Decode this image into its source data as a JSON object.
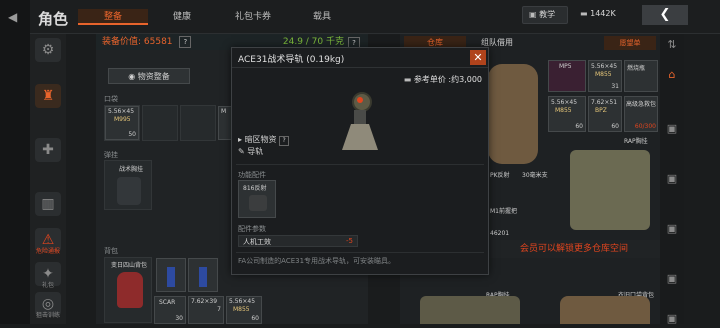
{
  "header": {
    "title": "角色",
    "tabs": [
      {
        "label": "整备",
        "active": true
      },
      {
        "label": "健康",
        "active": false
      },
      {
        "label": "礼包卡券",
        "active": false
      },
      {
        "label": "载具",
        "active": false
      }
    ],
    "teach_label": "教学",
    "currency_value": "1442K"
  },
  "sidebar": {
    "items": [
      {
        "icon": "robot-icon",
        "label": ""
      },
      {
        "icon": "equipment-icon",
        "label": ""
      },
      {
        "icon": "health-icon",
        "label": ""
      },
      {
        "icon": "bag-icon",
        "label": ""
      },
      {
        "icon": "alert-icon",
        "label": "危险通报"
      },
      {
        "icon": "gift-icon",
        "label": "礼包"
      },
      {
        "icon": "medal-icon",
        "label": "狙击训练"
      }
    ]
  },
  "left_panel": {
    "equip_value_label": "装备价值: 65581",
    "weight_label": "24.9 / 70 千克",
    "dispatch_button": "物资整备",
    "pocket_title": "口袋",
    "pocket_items": [
      {
        "caliber": "5.56×45",
        "type": "M995",
        "count": "50"
      },
      {
        "caliber": "",
        "type": "M",
        "count": ""
      }
    ],
    "chest_title": "弹挂",
    "chest_label": "战术胸挂",
    "backpack_title": "背包",
    "backpack_name": "变日四山背包",
    "backpack_items": [
      {
        "caliber": "",
        "type": "",
        "count": ""
      },
      {
        "caliber": "",
        "type": "",
        "count": ""
      },
      {
        "caliber": "7.62×39",
        "type": "",
        "count": "7"
      },
      {
        "caliber": "5.56×45",
        "type": "M855",
        "count": "60"
      }
    ],
    "gun_items": [
      {
        "name": "SCAR",
        "count": "30"
      }
    ]
  },
  "modal": {
    "title": "ACE31战术导轨 (0.19kg)",
    "price_label": "参考单价 :约3,000",
    "tags": [
      "暗区物资",
      "导轨"
    ],
    "section_accessory": "功能配件",
    "accessory_name": "816反射",
    "section_params": "配件参数",
    "param_name": "人机工效",
    "param_value": "-5",
    "description": "FA公司制造的ACE31专用战术导轨，可安装瞄具。",
    "close_label": "✕"
  },
  "right_panel": {
    "tabs": [
      {
        "label": "仓库",
        "active": true
      },
      {
        "label": "组队借用",
        "active": false
      }
    ],
    "list_button": "愿望单",
    "items_top": [
      {
        "name": "MP5",
        "count": "",
        "price": ""
      },
      {
        "name": "5.56×45",
        "count": "M855",
        "price": "31"
      },
      {
        "name": "燃烧瓶",
        "count": "",
        "price": ""
      },
      {
        "name": "5.56×45",
        "count": "M855",
        "price": "60"
      },
      {
        "name": "7.62×51",
        "count": "BPZ",
        "price": "60"
      },
      {
        "name": "高级急救包",
        "count": "",
        "price": "60/300"
      }
    ],
    "rap_label": "RAP胸挂",
    "pk_label": "PK反射",
    "scope_label": "30毫米支",
    "grip_label": "M1前握把",
    "number_label": "46201",
    "locked_banner": "会员可以解锁更多仓库空间",
    "bottom_rap": "RAP胸挂",
    "bottom_bag": "衣旧口袋背包"
  },
  "colors": {
    "accent": "#e8642c",
    "value_green": "#7dbb3c",
    "warning_red": "#e2451e"
  }
}
